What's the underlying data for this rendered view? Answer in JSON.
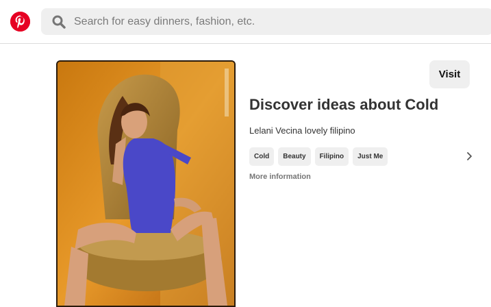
{
  "header": {
    "logo_icon": "pinterest-logo-icon",
    "brand_color": "#e60023",
    "search": {
      "icon": "search-icon",
      "placeholder": "Search for easy dinners, fashion, etc."
    }
  },
  "pin": {
    "image_icon": "pin-photo",
    "visit_label": "Visit",
    "title": "Discover ideas about Cold",
    "description": "Lelani Vecina lovely filipino",
    "tags": [
      "Cold",
      "Beauty",
      "Filipino",
      "Just Me"
    ],
    "tags_next_icon": "chevron-right-icon",
    "more_info_label": "More information"
  }
}
